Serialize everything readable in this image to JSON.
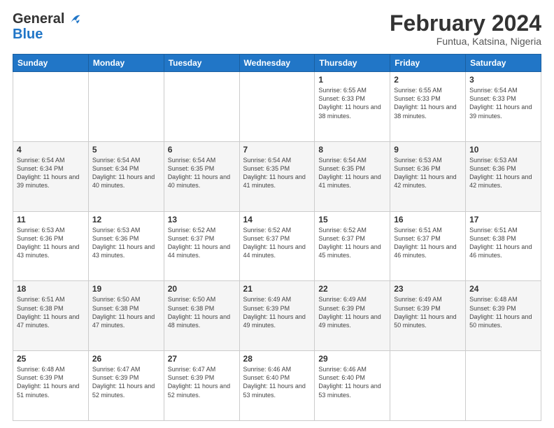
{
  "logo": {
    "general": "General",
    "blue": "Blue"
  },
  "header": {
    "month": "February 2024",
    "location": "Funtua, Katsina, Nigeria"
  },
  "days_of_week": [
    "Sunday",
    "Monday",
    "Tuesday",
    "Wednesday",
    "Thursday",
    "Friday",
    "Saturday"
  ],
  "weeks": [
    [
      {
        "day": "",
        "info": ""
      },
      {
        "day": "",
        "info": ""
      },
      {
        "day": "",
        "info": ""
      },
      {
        "day": "",
        "info": ""
      },
      {
        "day": "1",
        "info": "Sunrise: 6:55 AM\nSunset: 6:33 PM\nDaylight: 11 hours and 38 minutes."
      },
      {
        "day": "2",
        "info": "Sunrise: 6:55 AM\nSunset: 6:33 PM\nDaylight: 11 hours and 38 minutes."
      },
      {
        "day": "3",
        "info": "Sunrise: 6:54 AM\nSunset: 6:33 PM\nDaylight: 11 hours and 39 minutes."
      }
    ],
    [
      {
        "day": "4",
        "info": "Sunrise: 6:54 AM\nSunset: 6:34 PM\nDaylight: 11 hours and 39 minutes."
      },
      {
        "day": "5",
        "info": "Sunrise: 6:54 AM\nSunset: 6:34 PM\nDaylight: 11 hours and 40 minutes."
      },
      {
        "day": "6",
        "info": "Sunrise: 6:54 AM\nSunset: 6:35 PM\nDaylight: 11 hours and 40 minutes."
      },
      {
        "day": "7",
        "info": "Sunrise: 6:54 AM\nSunset: 6:35 PM\nDaylight: 11 hours and 41 minutes."
      },
      {
        "day": "8",
        "info": "Sunrise: 6:54 AM\nSunset: 6:35 PM\nDaylight: 11 hours and 41 minutes."
      },
      {
        "day": "9",
        "info": "Sunrise: 6:53 AM\nSunset: 6:36 PM\nDaylight: 11 hours and 42 minutes."
      },
      {
        "day": "10",
        "info": "Sunrise: 6:53 AM\nSunset: 6:36 PM\nDaylight: 11 hours and 42 minutes."
      }
    ],
    [
      {
        "day": "11",
        "info": "Sunrise: 6:53 AM\nSunset: 6:36 PM\nDaylight: 11 hours and 43 minutes."
      },
      {
        "day": "12",
        "info": "Sunrise: 6:53 AM\nSunset: 6:36 PM\nDaylight: 11 hours and 43 minutes."
      },
      {
        "day": "13",
        "info": "Sunrise: 6:52 AM\nSunset: 6:37 PM\nDaylight: 11 hours and 44 minutes."
      },
      {
        "day": "14",
        "info": "Sunrise: 6:52 AM\nSunset: 6:37 PM\nDaylight: 11 hours and 44 minutes."
      },
      {
        "day": "15",
        "info": "Sunrise: 6:52 AM\nSunset: 6:37 PM\nDaylight: 11 hours and 45 minutes."
      },
      {
        "day": "16",
        "info": "Sunrise: 6:51 AM\nSunset: 6:37 PM\nDaylight: 11 hours and 46 minutes."
      },
      {
        "day": "17",
        "info": "Sunrise: 6:51 AM\nSunset: 6:38 PM\nDaylight: 11 hours and 46 minutes."
      }
    ],
    [
      {
        "day": "18",
        "info": "Sunrise: 6:51 AM\nSunset: 6:38 PM\nDaylight: 11 hours and 47 minutes."
      },
      {
        "day": "19",
        "info": "Sunrise: 6:50 AM\nSunset: 6:38 PM\nDaylight: 11 hours and 47 minutes."
      },
      {
        "day": "20",
        "info": "Sunrise: 6:50 AM\nSunset: 6:38 PM\nDaylight: 11 hours and 48 minutes."
      },
      {
        "day": "21",
        "info": "Sunrise: 6:49 AM\nSunset: 6:39 PM\nDaylight: 11 hours and 49 minutes."
      },
      {
        "day": "22",
        "info": "Sunrise: 6:49 AM\nSunset: 6:39 PM\nDaylight: 11 hours and 49 minutes."
      },
      {
        "day": "23",
        "info": "Sunrise: 6:49 AM\nSunset: 6:39 PM\nDaylight: 11 hours and 50 minutes."
      },
      {
        "day": "24",
        "info": "Sunrise: 6:48 AM\nSunset: 6:39 PM\nDaylight: 11 hours and 50 minutes."
      }
    ],
    [
      {
        "day": "25",
        "info": "Sunrise: 6:48 AM\nSunset: 6:39 PM\nDaylight: 11 hours and 51 minutes."
      },
      {
        "day": "26",
        "info": "Sunrise: 6:47 AM\nSunset: 6:39 PM\nDaylight: 11 hours and 52 minutes."
      },
      {
        "day": "27",
        "info": "Sunrise: 6:47 AM\nSunset: 6:39 PM\nDaylight: 11 hours and 52 minutes."
      },
      {
        "day": "28",
        "info": "Sunrise: 6:46 AM\nSunset: 6:40 PM\nDaylight: 11 hours and 53 minutes."
      },
      {
        "day": "29",
        "info": "Sunrise: 6:46 AM\nSunset: 6:40 PM\nDaylight: 11 hours and 53 minutes."
      },
      {
        "day": "",
        "info": ""
      },
      {
        "day": "",
        "info": ""
      }
    ]
  ]
}
